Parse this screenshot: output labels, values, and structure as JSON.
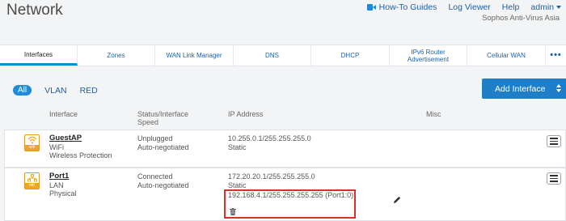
{
  "page": {
    "title": "Network"
  },
  "top_links": {
    "guides": "How-To Guides",
    "log_viewer": "Log Viewer",
    "help": "Help",
    "user": "admin",
    "subtitle": "Sophos Anti-Virus Asia"
  },
  "tabs": [
    {
      "label": "Interfaces",
      "active": true
    },
    {
      "label": "Zones"
    },
    {
      "label": "WAN Link Manager"
    },
    {
      "label": "DNS"
    },
    {
      "label": "DHCP"
    },
    {
      "label": "IPv6 Router Advertisement"
    },
    {
      "label": "Cellular WAN"
    },
    {
      "label": "•••"
    }
  ],
  "filters": {
    "all": "All",
    "vlan": "VLAN",
    "red": "RED"
  },
  "add_button": {
    "label": "Add Interface"
  },
  "columns": {
    "interface": "Interface",
    "status": "Status/Interface Speed",
    "ip": "IP Address",
    "misc": "Misc"
  },
  "rows": [
    {
      "icon": "wifi-icon",
      "icon_tag": "wifi",
      "name": "GuestAP",
      "zone": "WiFi",
      "type": "Wireless Protection",
      "status": "Unplugged",
      "speed": "Auto-negotiated",
      "ip": "10.255.0.1/255.255.255.0",
      "ip_mode": "Static"
    },
    {
      "icon": "network-icon",
      "icon_tag": "eth",
      "name": "Port1",
      "zone": "LAN",
      "type": "Physical",
      "status": "Connected",
      "speed": "Auto-negotiated",
      "ip": "172.20.20.1/255.255.255.0",
      "ip_mode": "Static",
      "alias_ip": "192.168.4.1/255.255.255.255 (Port1:0)"
    }
  ],
  "colors": {
    "accent": "#1e7fc8",
    "highlight": "#d9302c",
    "icon_orange": "#f0a623"
  }
}
